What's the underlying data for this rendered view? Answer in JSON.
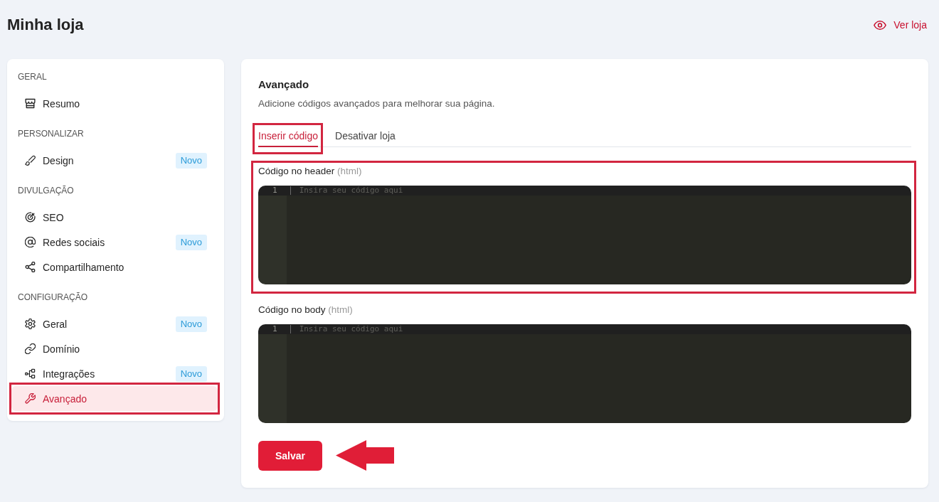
{
  "header": {
    "title": "Minha loja",
    "link": "Ver loja"
  },
  "sidebar": {
    "sections": [
      {
        "heading": "GERAL",
        "items": [
          {
            "label": "Resumo",
            "selected": false,
            "annotated": false
          }
        ]
      },
      {
        "heading": "PERSONALIZAR",
        "items": [
          {
            "label": "Design",
            "badge": "Novo",
            "selected": false,
            "annotated": false
          }
        ]
      },
      {
        "heading": "DIVULGAÇÃO",
        "items": [
          {
            "label": "SEO",
            "selected": false,
            "annotated": false
          },
          {
            "label": "Redes sociais",
            "badge": "Novo",
            "selected": false,
            "annotated": false
          },
          {
            "label": "Compartilhamento",
            "selected": false,
            "annotated": false
          }
        ]
      },
      {
        "heading": "CONFIGURAÇÃO",
        "items": [
          {
            "label": "Geral",
            "badge": "Novo",
            "selected": false,
            "annotated": false
          },
          {
            "label": "Domínio",
            "selected": false,
            "annotated": false
          },
          {
            "label": "Integrações",
            "badge": "Novo",
            "selected": false,
            "annotated": false
          },
          {
            "label": "Avançado",
            "selected": true,
            "annotated": true
          }
        ]
      }
    ]
  },
  "panel": {
    "title": "Avançado",
    "description": "Adicione códigos avançados para melhorar sua página.",
    "tabs": [
      {
        "label": "Inserir código",
        "selected": true,
        "annotated": true
      },
      {
        "label": "Desativar loja",
        "selected": false,
        "annotated": false
      }
    ],
    "editors": [
      {
        "label": "Código no header",
        "hint": "(html)",
        "line_number": "1",
        "placeholder": "Insira seu código aqui",
        "annotated": true
      },
      {
        "label": "Código no body",
        "hint": "(html)",
        "line_number": "1",
        "placeholder": "Insira seu código aqui",
        "annotated": false
      }
    ],
    "save_button": {
      "label": "Salvar",
      "annotation_arrow": true
    }
  }
}
